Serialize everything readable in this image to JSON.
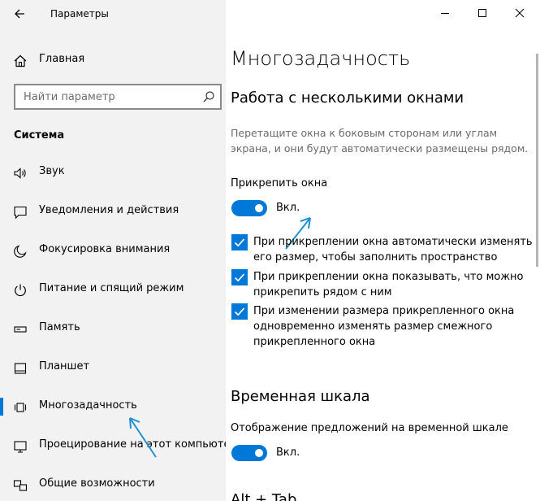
{
  "window": {
    "title": "Параметры"
  },
  "sidebar": {
    "home_label": "Главная",
    "search_placeholder": "Найти параметр",
    "section_label": "Система",
    "items": [
      {
        "label": "Звук",
        "icon": "speaker-icon"
      },
      {
        "label": "Уведомления и действия",
        "icon": "notification-icon"
      },
      {
        "label": "Фокусировка внимания",
        "icon": "moon-icon"
      },
      {
        "label": "Питание и спящий режим",
        "icon": "power-icon"
      },
      {
        "label": "Память",
        "icon": "storage-icon"
      },
      {
        "label": "Планшет",
        "icon": "tablet-icon"
      },
      {
        "label": "Многозадачность",
        "icon": "multitasking-icon",
        "selected": true
      },
      {
        "label": "Проецирование на этот компьютер",
        "icon": "projection-icon"
      },
      {
        "label": "Общие возможности",
        "icon": "shared-experiences-icon"
      }
    ]
  },
  "main": {
    "page_title": "Многозадачность",
    "snap": {
      "heading": "Работа с несколькими окнами",
      "description": "Перетащите окна к боковым сторонам или углам экрана, и они будут автоматически размещены рядом.",
      "toggle_label": "Прикрепить окна",
      "toggle_state": "Вкл.",
      "toggle_on": true,
      "options": [
        {
          "text": "При прикреплении окна автоматически изменять его размер, чтобы заполнить пространство",
          "checked": true
        },
        {
          "text": "При прикреплении окна показывать, что можно прикрепить рядом с ним",
          "checked": true
        },
        {
          "text": "При изменении размера прикрепленного окна одновременно изменять размер смежного прикрепленного окна",
          "checked": true
        }
      ]
    },
    "timeline": {
      "heading": "Временная шкала",
      "toggle_label": "Отображение предложений на временной шкале",
      "toggle_state": "Вкл.",
      "toggle_on": true
    },
    "next_heading_partial": "Alt + Tab"
  },
  "colors": {
    "accent": "#0078d7",
    "sidebar_bg": "#f2f2f2",
    "annotation": "#1f8fd6"
  }
}
